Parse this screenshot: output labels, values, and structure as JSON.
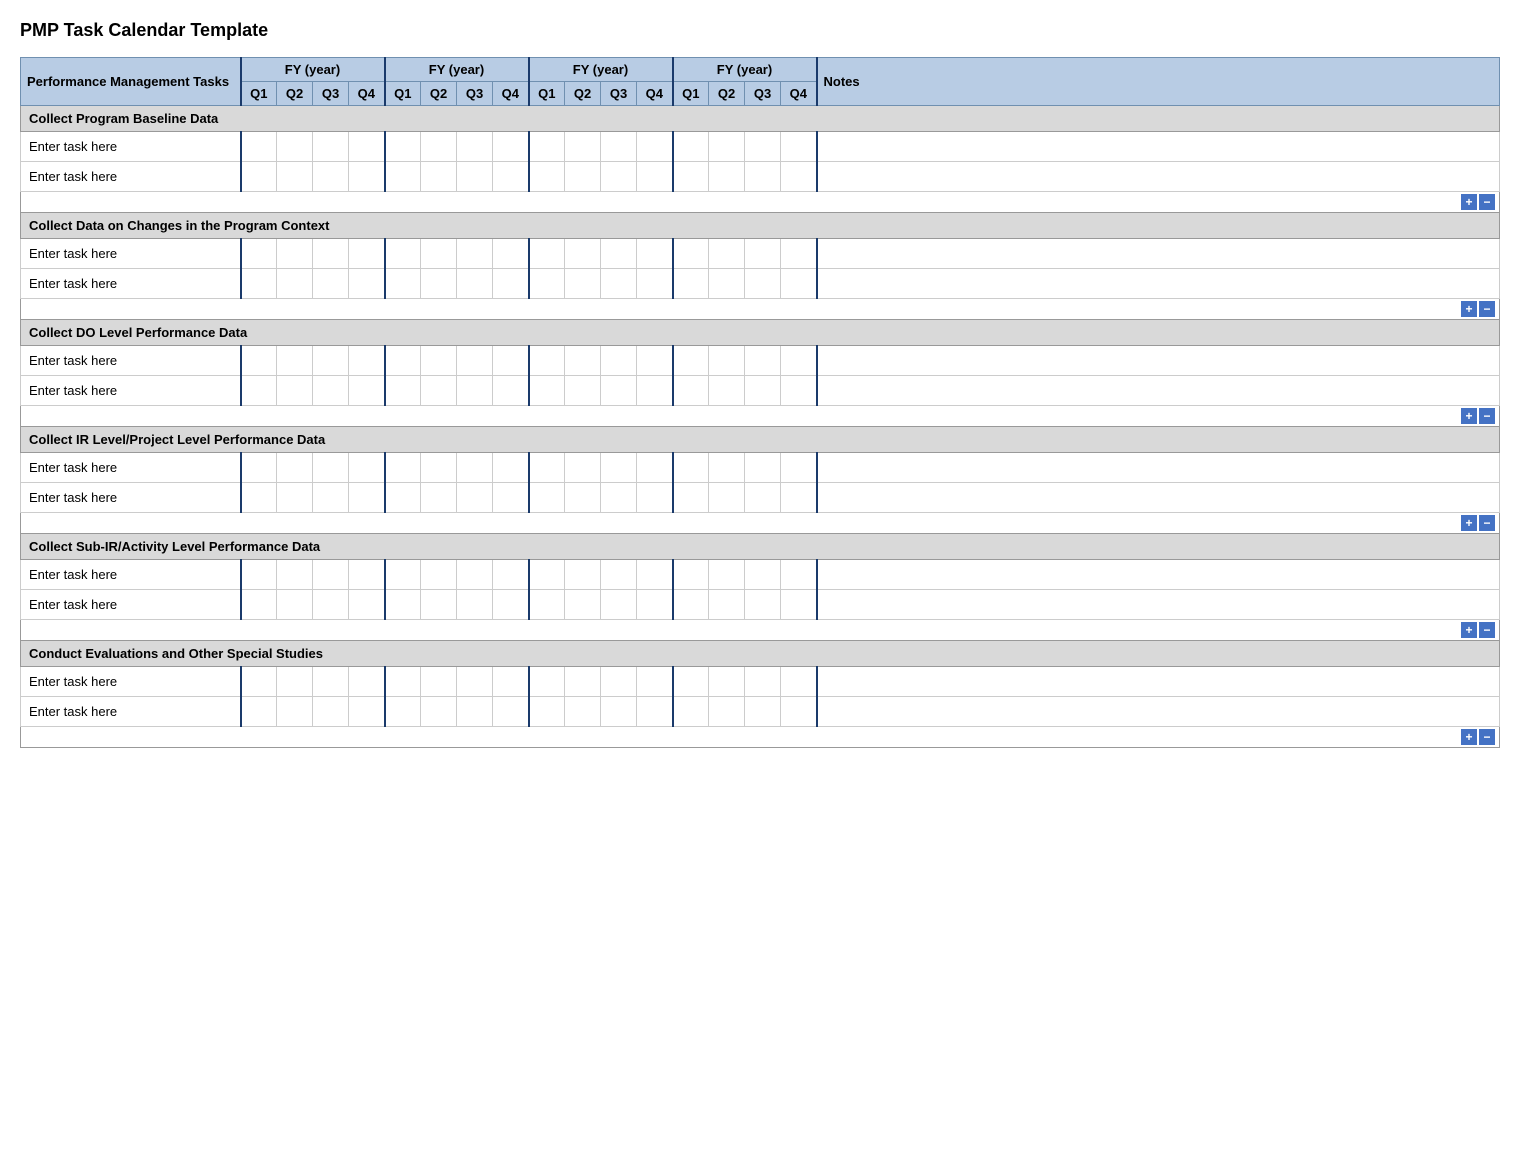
{
  "page": {
    "title": "PMP Task Calendar Template"
  },
  "header": {
    "task_column": "Performance Management Tasks",
    "fy_label": "FY  (year)",
    "notes_label": "Notes",
    "quarters": [
      "Q1",
      "Q2",
      "Q3",
      "Q4"
    ]
  },
  "sections": [
    {
      "id": "section-1",
      "label": "Collect Program Baseline Data",
      "tasks": [
        {
          "name": "Enter task here"
        },
        {
          "name": "Enter task here"
        }
      ]
    },
    {
      "id": "section-2",
      "label": "Collect Data on Changes in the Program Context",
      "tasks": [
        {
          "name": "Enter task here"
        },
        {
          "name": "Enter task here"
        }
      ]
    },
    {
      "id": "section-3",
      "label": "Collect DO Level Performance Data",
      "tasks": [
        {
          "name": "Enter task here"
        },
        {
          "name": "Enter task here"
        }
      ]
    },
    {
      "id": "section-4",
      "label": "Collect IR Level/Project Level Performance Data",
      "tasks": [
        {
          "name": "Enter task here"
        },
        {
          "name": "Enter task here"
        }
      ]
    },
    {
      "id": "section-5",
      "label": "Collect Sub-IR/Activity Level Performance Data",
      "tasks": [
        {
          "name": "Enter task here"
        },
        {
          "name": "Enter task here"
        }
      ]
    },
    {
      "id": "section-6",
      "label": "Conduct Evaluations and Other Special Studies",
      "tasks": [
        {
          "name": "Enter task here"
        },
        {
          "name": "Enter task here"
        }
      ]
    }
  ],
  "buttons": {
    "plus_label": "+",
    "minus_label": "−"
  }
}
